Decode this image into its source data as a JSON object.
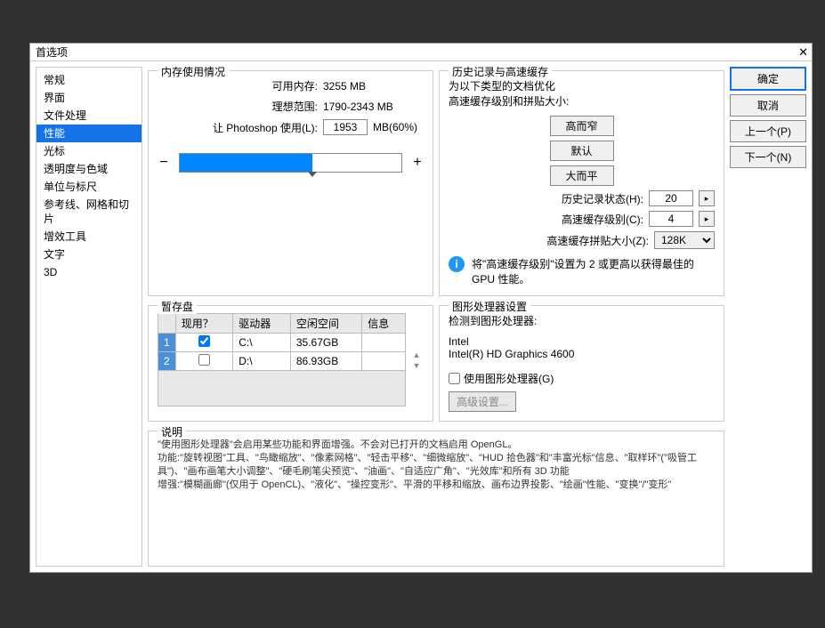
{
  "dialog": {
    "title": "首选项"
  },
  "sidebar": {
    "items": [
      {
        "label": "常规"
      },
      {
        "label": "界面"
      },
      {
        "label": "文件处理"
      },
      {
        "label": "性能",
        "selected": true
      },
      {
        "label": "光标"
      },
      {
        "label": "透明度与色域"
      },
      {
        "label": "单位与标尺"
      },
      {
        "label": "参考线、网格和切片"
      },
      {
        "label": "增效工具"
      },
      {
        "label": "文字"
      },
      {
        "label": "3D"
      }
    ]
  },
  "buttons": {
    "ok": "确定",
    "cancel": "取消",
    "prev": "上一个(P)",
    "next": "下一个(N)"
  },
  "memory": {
    "legend": "内存使用情况",
    "available_label": "可用内存:",
    "available_value": "3255 MB",
    "ideal_label": "理想范围:",
    "ideal_value": "1790-2343 MB",
    "let_use_label": "让 Photoshop 使用(L):",
    "let_use_value": "1953",
    "let_use_unit": "MB(60%)"
  },
  "history": {
    "legend": "历史记录与高速缓存",
    "optimize_label": "为以下类型的文档优化\n高速缓存级别和拼贴大小:",
    "btn_tall": "高而窄",
    "btn_default": "默认",
    "btn_wide": "大而平",
    "states_label": "历史记录状态(H):",
    "states_value": "20",
    "levels_label": "高速缓存级别(C):",
    "levels_value": "4",
    "tile_label": "高速缓存拼贴大小(Z):",
    "tile_value": "128K",
    "note": "将\"高速缓存级别\"设置为 2 或更高以获得最佳的 GPU 性能。"
  },
  "scratch": {
    "legend": "暂存盘",
    "cols": {
      "active": "现用？",
      "drive": "驱动器",
      "space": "空闲空间",
      "info": "信息"
    },
    "rows": [
      {
        "num": "1",
        "checked": true,
        "drive": "C:\\",
        "space": "35.67GB"
      },
      {
        "num": "2",
        "checked": false,
        "drive": "D:\\",
        "space": "86.93GB"
      }
    ]
  },
  "gpu": {
    "legend": "图形处理器设置",
    "detected_label": "检测到图形处理器:",
    "vendor": "Intel",
    "model": "Intel(R) HD Graphics 4600",
    "use_gpu_label": "使用图形处理器(G)",
    "advanced_btn": "高级设置..."
  },
  "description": {
    "legend": "说明",
    "text": "\"使用图形处理器\"会启用某些功能和界面增强。不会对已打开的文档启用 OpenGL。\n功能:\"旋转视图\"工具、\"鸟瞰缩放\"、\"像素网格\"、\"轻击平移\"、\"细微缩放\"、\"HUD 拾色器\"和\"丰富光标\"信息、\"取样环\"(\"吸管工具\")、\"画布画笔大小调整\"、\"硬毛刷笔尖预览\"、\"油画\"、\"自适应广角\"、\"光效库\"和所有 3D 功能\n增强:\"模糊画廊\"(仅用于 OpenCL)、\"液化\"、\"操控变形\"、平滑的平移和缩放、画布边界投影、\"绘画\"性能、\"变换\"/\"变形\""
  }
}
